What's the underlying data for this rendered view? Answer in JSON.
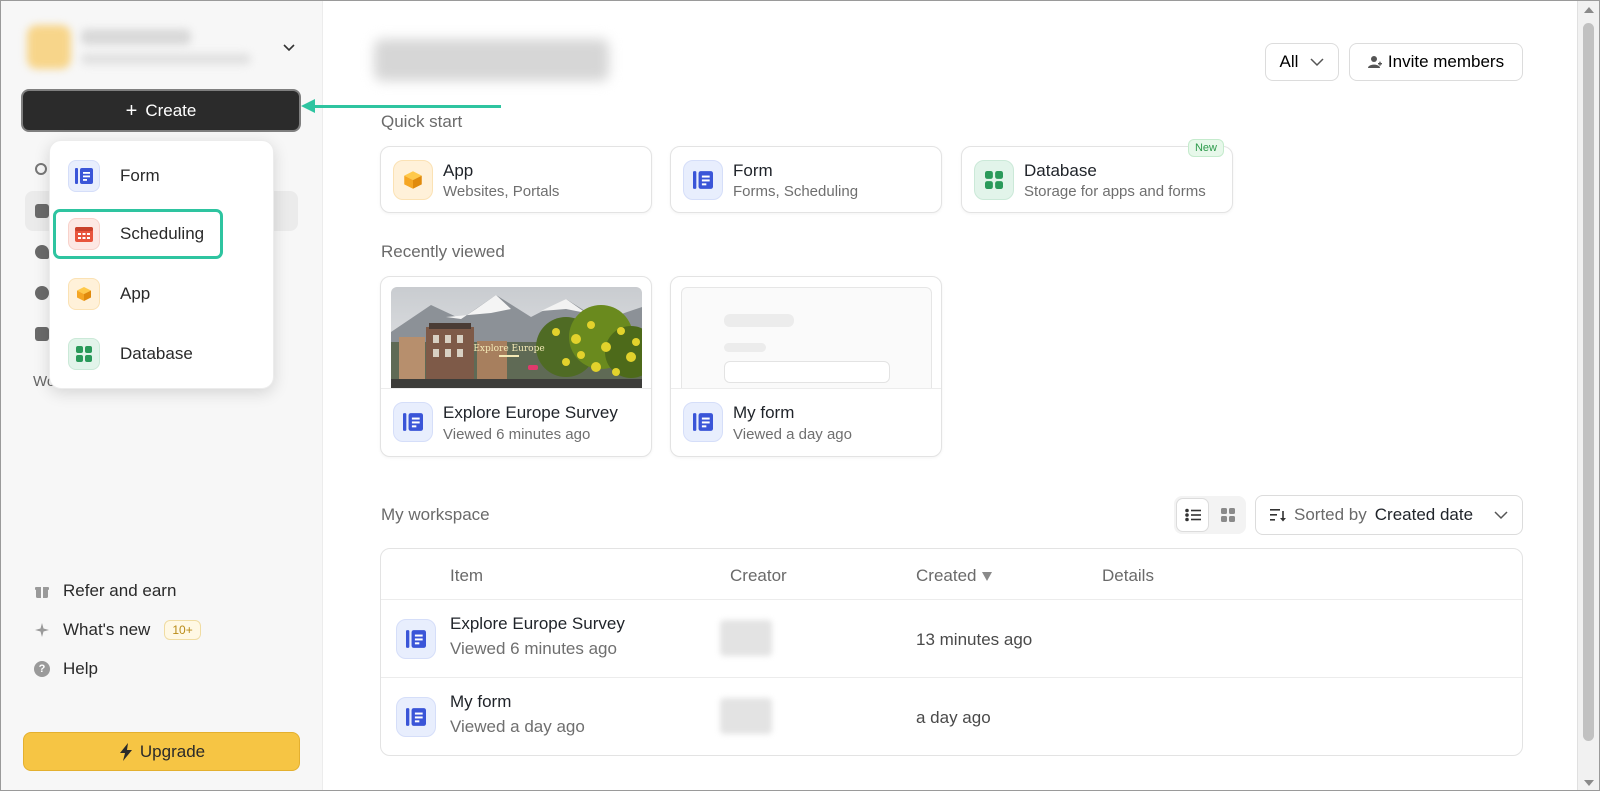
{
  "sidebar": {
    "create_label": "Create",
    "create_icon": "plus-icon",
    "workspace_peek": "Wo",
    "bottom_items": [
      {
        "label": "Refer and earn",
        "icon": "gift-icon"
      },
      {
        "label": "What's new",
        "icon": "sparkle-icon",
        "badge": "10+"
      },
      {
        "label": "Help",
        "icon": "help-icon"
      }
    ],
    "upgrade_label": "Upgrade",
    "upgrade_icon": "bolt-icon"
  },
  "create_menu": {
    "items": [
      {
        "label": "Form",
        "icon": "form-icon"
      },
      {
        "label": "Scheduling",
        "icon": "calendar-icon",
        "highlighted": true
      },
      {
        "label": "App",
        "icon": "app-cube-icon"
      },
      {
        "label": "Database",
        "icon": "database-icon"
      }
    ]
  },
  "header": {
    "filter_label": "All",
    "invite_label": "Invite members"
  },
  "quick_start": {
    "title": "Quick start",
    "cards": [
      {
        "title": "App",
        "subtitle": "Websites, Portals",
        "icon": "app-cube-icon"
      },
      {
        "title": "Form",
        "subtitle": "Forms, Scheduling",
        "icon": "form-icon"
      },
      {
        "title": "Database",
        "subtitle": "Storage for apps and forms",
        "icon": "database-icon",
        "badge": "New"
      }
    ]
  },
  "recently_viewed": {
    "title": "Recently viewed",
    "cards": [
      {
        "title": "Explore Europe Survey",
        "subtitle": "Viewed 6 minutes ago",
        "thumb_text": "Explore Europe"
      },
      {
        "title": "My form",
        "subtitle": "Viewed a day ago"
      }
    ]
  },
  "workspace": {
    "title": "My workspace",
    "sort_prefix": "Sorted by",
    "sort_value": "Created date",
    "columns": {
      "item": "Item",
      "creator": "Creator",
      "created": "Created",
      "details": "Details"
    },
    "rows": [
      {
        "name": "Explore Europe Survey",
        "sub": "Viewed 6 minutes ago",
        "created": "13 minutes ago"
      },
      {
        "name": "My form",
        "sub": "Viewed a day ago",
        "created": "a day ago"
      }
    ]
  },
  "colors": {
    "accent_teal": "#2ec4a0",
    "create_bg": "#2b2b2b",
    "upgrade_bg": "#f6c544",
    "form_blue": "#3a55d8",
    "sched_red": "#e8553d",
    "app_orange": "#f5a623",
    "db_green": "#2a9a5a"
  }
}
